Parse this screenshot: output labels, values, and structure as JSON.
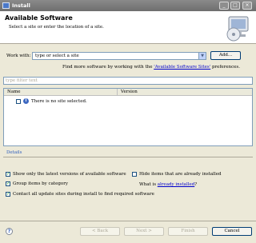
{
  "window": {
    "title": "Install",
    "minimize": "_",
    "maximize": "□",
    "close": "×"
  },
  "header": {
    "title": "Available Software",
    "subtitle": "Select a site or enter the location of a site."
  },
  "work_with": {
    "label": "Work with:",
    "combo_placeholder": "type or select a site",
    "add_label": "Add...",
    "find_more_prefix": "Find more software by working with the",
    "find_more_link": "'Available Software Sites'",
    "find_more_suffix": "preferences."
  },
  "filter": {
    "placeholder": "type filter text"
  },
  "table": {
    "columns": [
      "Name",
      "Version"
    ],
    "rows": [
      {
        "name": "There is no site selected.",
        "version": "",
        "checked": false
      }
    ]
  },
  "details": {
    "label": "Details"
  },
  "options": {
    "latest_versions": {
      "label": "Show only the latest versions of available software",
      "checked": true
    },
    "group_by_category": {
      "label": "Group items by category",
      "checked": true
    },
    "contact_sites": {
      "label": "Contact all update sites during install to find required software",
      "checked": true
    },
    "hide_installed": {
      "label": "Hide items that are already installed",
      "checked": false
    },
    "what_is_prefix": "What is",
    "what_is_link": "already installed",
    "what_is_suffix": "?"
  },
  "footer": {
    "back": "< Back",
    "next": "Next >",
    "finish": "Finish",
    "cancel": "Cancel"
  },
  "colors": {
    "accent": "#0000cc",
    "titlebar": "#7a7a7a",
    "dialog_bg": "#ece9d8"
  }
}
